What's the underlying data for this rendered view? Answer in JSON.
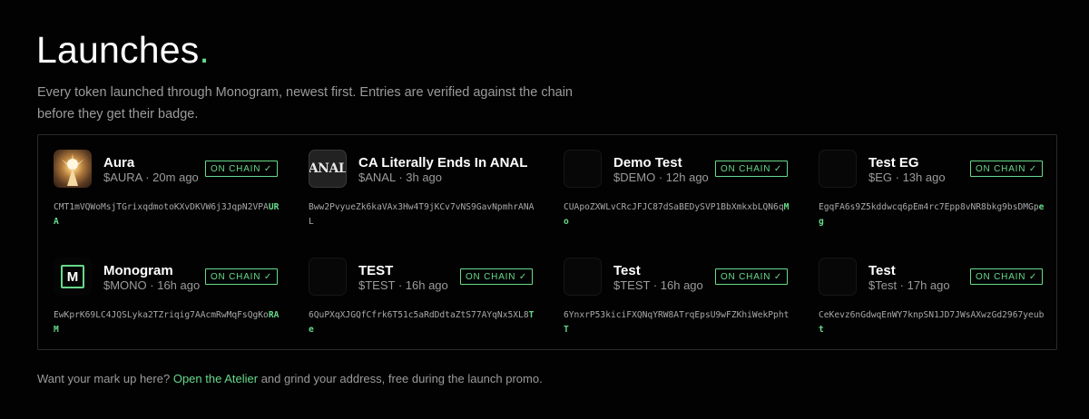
{
  "header": {
    "title": "Launches",
    "title_dot": ".",
    "description": "Every token launched through Monogram, newest first. Entries are verified against the chain before they get their badge."
  },
  "badge_label": "ON CHAIN ✓",
  "tokens": [
    {
      "name": "Aura",
      "meta": "$AURA · 20m ago",
      "addr_prefix": "CMT1mVQWoMsjTGrixqdmotoKXvDKVW6j3JqpN2VPA",
      "addr_suffix": "URA",
      "logo": "aura-logo"
    },
    {
      "name": "CA Literally Ends In ANAL",
      "meta": "$ANAL · 3h ago",
      "addr_prefix": "Bww2PvyueZk6kaVAx3Hw4T9jKCv7vNS9GavNpmhrA",
      "addr_suffix": "NAL",
      "logo_text": "ANAL"
    },
    {
      "name": "Demo Test",
      "meta": "$DEMO · 12h ago",
      "addr_prefix": "CUApoZXWLvCRcJFJC87dSaBEDySVP1BbXmkxbLQN6q",
      "addr_suffix": "Mo",
      "logo": "blank-logo"
    },
    {
      "name": "Test EG",
      "meta": "$EG · 13h ago",
      "addr_prefix": "EgqFA6s9Z5kddwcq6pEm4rc7Epp8vNR8bkg9bsDMGp",
      "addr_suffix": "eg",
      "logo": "blank-logo"
    },
    {
      "name": "Monogram",
      "meta": "$MONO · 16h ago",
      "addr_prefix": "EwKprK69LC4JQSLyka2TZriqig7AAcmRwMqFsQgKo",
      "addr_suffix": "RAM",
      "logo_text": "M"
    },
    {
      "name": "TEST",
      "meta": "$TEST · 16h ago",
      "addr_prefix": "6QuPXqXJGQfCfrk6T51c5aRdDdtaZtS77AYqNx5XL8",
      "addr_suffix": "Te",
      "logo": "blank-logo"
    },
    {
      "name": "Test",
      "meta": "$TEST · 16h ago",
      "addr_prefix": "6YnxrP53kiciFXQNqYRW8ATrqEpsU9wFZKhiWekPpht",
      "addr_suffix": "T",
      "logo": "blank-logo"
    },
    {
      "name": "Test",
      "meta": "$Test · 17h ago",
      "addr_prefix": "CeKevz6nGdwqEnWY7knpSN1JD7JWsAXwzGd2967yeub",
      "addr_suffix": "t",
      "logo": "blank-logo"
    }
  ],
  "footer": {
    "prefix": "Want your mark up here?",
    "link": "Open the Atelier",
    "suffix": "and grind your address, free during the launch promo."
  },
  "colors": {
    "accent": "#67d98b",
    "background": "#020202",
    "muted": "#9b9b9b"
  }
}
